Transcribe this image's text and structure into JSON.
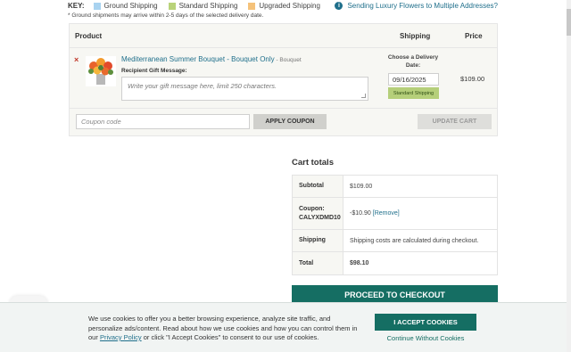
{
  "key": {
    "label": "KEY:",
    "items": [
      {
        "label": "Ground Shipping",
        "color": "#a9d3f0"
      },
      {
        "label": "Standard Shipping",
        "color": "#b9d37a"
      },
      {
        "label": "Upgraded Shipping",
        "color": "#f5c27a"
      }
    ],
    "note": "* Ground shipments may arrive within 2-5 days of the selected delivery date.",
    "sending_link": "Sending Luxury Flowers to Multiple Addresses?",
    "info_icon": "info-circle-icon"
  },
  "cart_table": {
    "headers": {
      "product": "Product",
      "shipping": "Shipping",
      "price": "Price"
    },
    "item": {
      "remove": "×",
      "name": "Mediterranean Summer Bouquet - Bouquet Only",
      "type": " - Bouquet",
      "gift_label": "Recipient Gift Message:",
      "gift_placeholder": "Write your gift message here, limit 250 characters.",
      "choose_date": "Choose a Delivery Date:",
      "date": "09/16/2025",
      "shipping_badge": "Standard Shipping",
      "price": "$109.00"
    },
    "coupon_placeholder": "Coupon code",
    "apply_coupon": "APPLY COUPON",
    "update_cart": "UPDATE CART"
  },
  "totals": {
    "title": "Cart totals",
    "subtotal_label": "Subtotal",
    "subtotal_value": "$109.00",
    "coupon_label": "Coupon: CALYXDMD10",
    "coupon_value": "-$10.90",
    "coupon_remove": "[Remove]",
    "shipping_label": "Shipping",
    "shipping_value": "Shipping costs are calculated during checkout.",
    "total_label": "Total",
    "total_value": "$98.10",
    "checkout": "PROCEED TO CHECKOUT"
  },
  "cookie": {
    "text_before": "We use cookies to offer you a better browsing experience, analyze site traffic, and personalize ads/content. Read about how we use cookies and how you can control them in our ",
    "privacy_link": "Privacy Policy",
    "text_after": " or click \"I Accept Cookies\" to consent to our use of cookies.",
    "accept": "I ACCEPT COOKIES",
    "continue": "Continue Without Cookies"
  }
}
